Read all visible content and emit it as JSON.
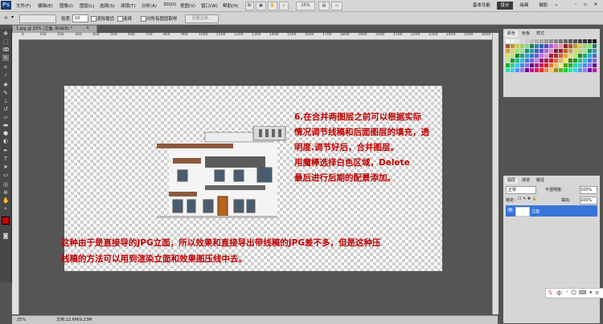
{
  "menubar": {
    "logo": "Ps",
    "items": [
      "文件(F)",
      "编辑(E)",
      "图像(I)",
      "图层(L)",
      "选择(S)",
      "滤镜(T)",
      "分析(A)",
      "3D(D)",
      "视图(V)",
      "窗口(W)",
      "帮助(H)"
    ],
    "zoom": "25%",
    "workspaces": [
      "基本功能",
      "设计",
      "绘画",
      "摄影"
    ],
    "active_workspace": "设计",
    "more": "»"
  },
  "options": {
    "feather_label": "容差:",
    "feather_value": "10",
    "antialias_label": "消除锯齿",
    "contiguous_label": "连续",
    "all_layers_label": "对所有图层取样",
    "refine_label": "调整边缘..."
  },
  "document": {
    "tab_title": "1.jpg @ 25% (立面, RGB/8) *",
    "zoom_status": "25%",
    "doc_size": "文档:22.6M/9.23M",
    "ruler_marks": [
      "0",
      "100",
      "200",
      "300",
      "400",
      "500",
      "600",
      "700",
      "800",
      "900",
      "1000",
      "1100",
      "1200",
      "1300",
      "1400",
      "1500",
      "1600",
      "1700",
      "1800",
      "1900",
      "2000",
      "2100",
      "2200",
      "2300",
      "2400",
      "2500",
      "2600"
    ]
  },
  "annotation": {
    "lines": [
      "6.在合并两图层之前可以根据实际",
      "情况调节线稿和后面图层的填充，透",
      "明度.调节好后，合并图层。",
      "用魔棒选择白色区域，Delete",
      "最后进行后期的配景添加。"
    ],
    "bottom_lines": [
      "这种由于是直接导的JPG立面，所以效果和直接导出带线稿的JPG差不多，但是这种压",
      "线稿的方法可以用到渲染立面和效果图压线中去。"
    ]
  },
  "panels": {
    "color_tabs": [
      "颜色",
      "色板",
      "样式"
    ],
    "layer_tabs": [
      "图层",
      "通道",
      "路径"
    ],
    "blend_mode": "正常",
    "opacity_label": "不透明度:",
    "opacity_value": "100%",
    "lock_label": "锁定:",
    "fill_label": "填充:",
    "fill_value": "100%",
    "layer_name": "立面",
    "ime_text": "中"
  },
  "colors": {
    "foreground": "#cc0000",
    "background": "#ffffff",
    "annotation": "#c00000"
  }
}
